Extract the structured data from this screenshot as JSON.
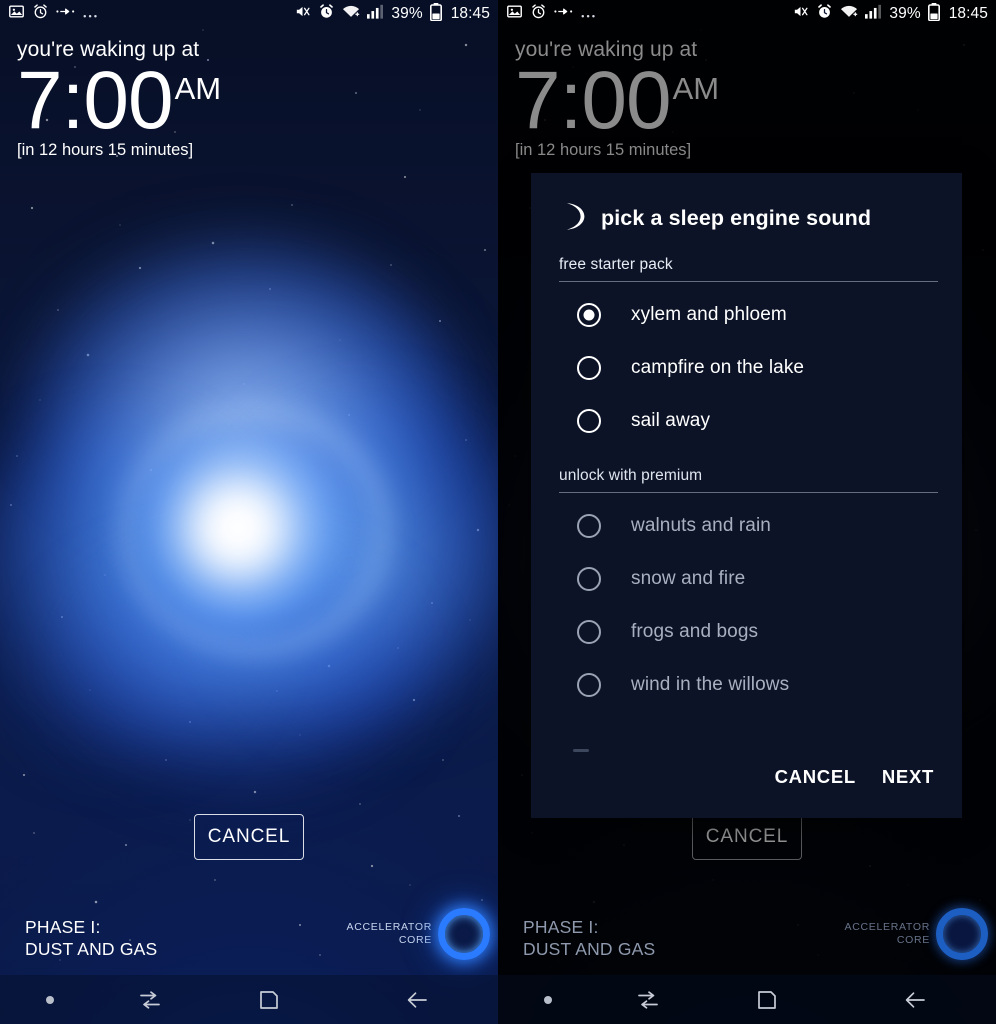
{
  "statusbar": {
    "left_icons": [
      "image-icon",
      "alarm-clock-icon",
      "data-transfer-icon",
      "more-icons-ellipsis"
    ],
    "right_icons": [
      "mute-vibrate-icon",
      "alarm-clock-icon",
      "wifi-icon",
      "signal-bars-icon",
      "battery-icon"
    ],
    "battery_percent": "39%",
    "clock": "18:45"
  },
  "screen": {
    "lead_text": "you're waking up at",
    "time": "7:00",
    "ampm": "AM",
    "countdown": "[in 12 hours 15 minutes]",
    "cancel_label": "CANCEL",
    "phase_line1": "PHASE I:",
    "phase_line2": "DUST AND GAS",
    "accelerator_line1": "ACCELERATOR",
    "accelerator_line2": "CORE"
  },
  "dialog": {
    "title": "pick a sleep engine sound",
    "icon": "crescent-moon-icon",
    "sections": [
      {
        "label": "free starter pack",
        "locked": false,
        "options": [
          {
            "label": "xylem and phloem",
            "selected": true
          },
          {
            "label": "campfire on the lake",
            "selected": false
          },
          {
            "label": "sail away",
            "selected": false
          }
        ]
      },
      {
        "label": "unlock with premium",
        "locked": true,
        "options": [
          {
            "label": "walnuts and rain",
            "selected": false
          },
          {
            "label": "snow and fire",
            "selected": false
          },
          {
            "label": "frogs and bogs",
            "selected": false
          },
          {
            "label": "wind in the willows",
            "selected": false
          }
        ]
      }
    ],
    "cancel_label": "CANCEL",
    "next_label": "NEXT"
  },
  "navbar": {
    "items": [
      "status-dot",
      "recents-icon",
      "home-icon",
      "back-icon"
    ]
  },
  "colors": {
    "accent_blue": "#2a7bff",
    "dialog_bg": "#0c1326",
    "space_navy": "#0b1a42",
    "text_primary": "#ffffff",
    "text_locked": "#a8b0c0"
  }
}
